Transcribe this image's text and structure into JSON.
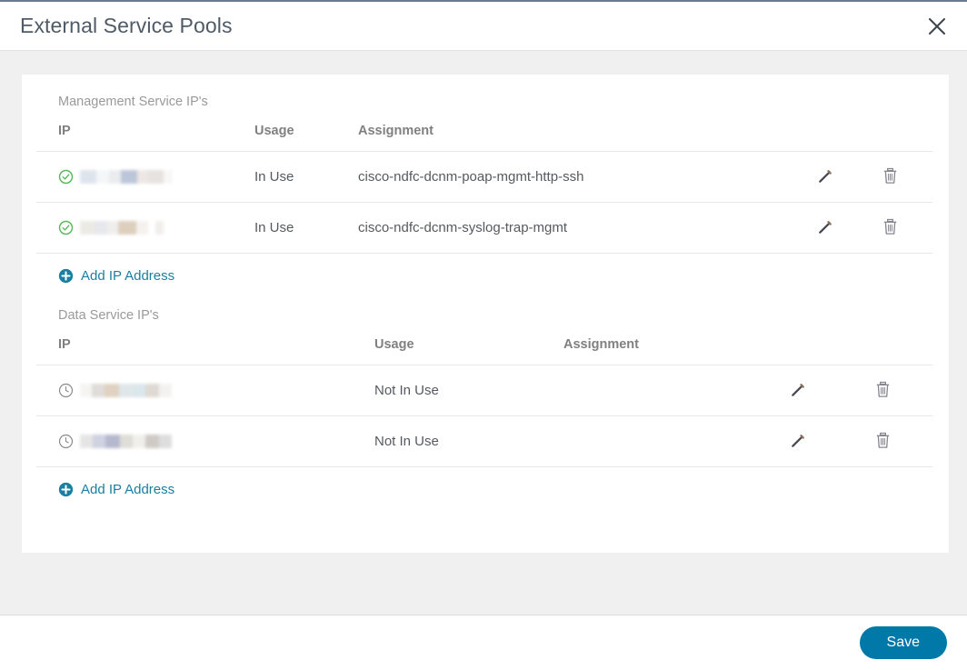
{
  "header": {
    "title": "External Service Pools",
    "close_icon": "close-icon"
  },
  "colors": {
    "accent_link": "#1a7fa0",
    "save_button": "#0079a8",
    "status_in_use": "#5cb85c",
    "status_not_in_use": "#8a8a8a",
    "page_background": "#f0f0f0",
    "card_background": "#ffffff",
    "title_text": "#4f5b66"
  },
  "sections": [
    {
      "label": "Management Service IP's",
      "columns": {
        "ip": "IP",
        "usage": "Usage",
        "assignment": "Assignment"
      },
      "rows": [
        {
          "status_icon": "check-circle-icon",
          "ip": "",
          "usage": "In Use",
          "assignment": "cisco-ndfc-dcnm-poap-mgmt-http-ssh",
          "edit_icon": "pencil-icon",
          "delete_icon": "trash-icon"
        },
        {
          "status_icon": "check-circle-icon",
          "ip": "",
          "usage": "In Use",
          "assignment": "cisco-ndfc-dcnm-syslog-trap-mgmt",
          "edit_icon": "pencil-icon",
          "delete_icon": "trash-icon"
        }
      ],
      "add_label": "Add IP Address"
    },
    {
      "label": "Data Service IP's",
      "columns": {
        "ip": "IP",
        "usage": "Usage",
        "assignment": "Assignment"
      },
      "rows": [
        {
          "status_icon": "clock-icon",
          "ip": "",
          "usage": "Not In Use",
          "assignment": "",
          "edit_icon": "pencil-icon",
          "delete_icon": "trash-icon"
        },
        {
          "status_icon": "clock-icon",
          "ip": "",
          "usage": "Not In Use",
          "assignment": "",
          "edit_icon": "pencil-icon",
          "delete_icon": "trash-icon"
        }
      ],
      "add_label": "Add IP Address"
    }
  ],
  "footer": {
    "save_label": "Save"
  }
}
